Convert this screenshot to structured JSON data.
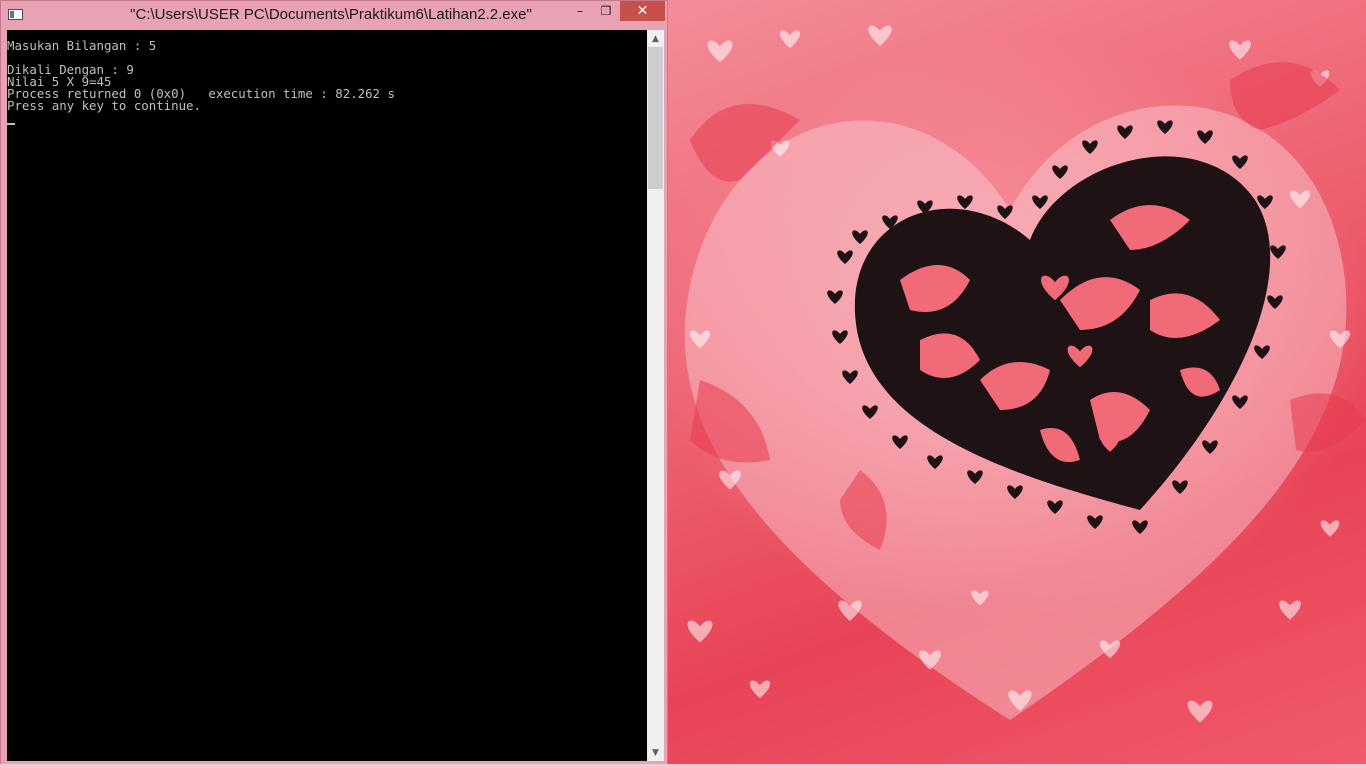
{
  "window": {
    "title": "\"C:\\Users\\USER PC\\Documents\\Praktikum6\\Latihan2.2.exe\"",
    "icon": "console-app-icon",
    "controls": {
      "minimize": "–",
      "restore": "❐",
      "close": "✕"
    }
  },
  "console": {
    "lines": [
      "Masukan Bilangan : 5",
      "",
      "Dikali Dengan : 9",
      "Nilai 5 X 9=45",
      "Process returned 0 (0x0)   execution time : 82.262 s",
      "Press any key to continue."
    ]
  },
  "scrollbar": {
    "up_arrow": "▲",
    "down_arrow": "▼"
  },
  "colors": {
    "titlebar": "#e8a2b3",
    "close_button": "#c7504b",
    "console_background": "#000000",
    "console_text": "#c0c0c0",
    "wallpaper_heart": "#1e1214"
  },
  "wallpaper": {
    "icon": "heart-wallpaper"
  }
}
